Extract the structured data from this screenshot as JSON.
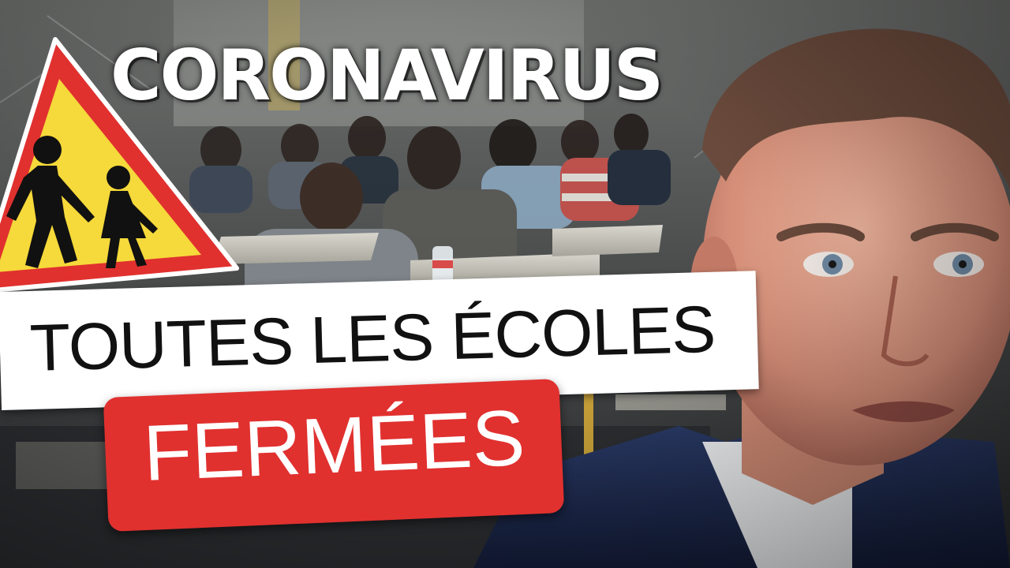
{
  "headline": "CORONAVIRUS",
  "banner_white": "TOUTES LES ÉCOLES",
  "banner_red": "FERMÉES",
  "icons": {
    "sign": "school-children-warning-sign-icon"
  },
  "colors": {
    "sign_red": "#e0312f",
    "sign_yellow": "#f6d93a",
    "banner_red": "#e0312f",
    "banner_white": "#ffffff",
    "headline_text": "#ffffff"
  }
}
